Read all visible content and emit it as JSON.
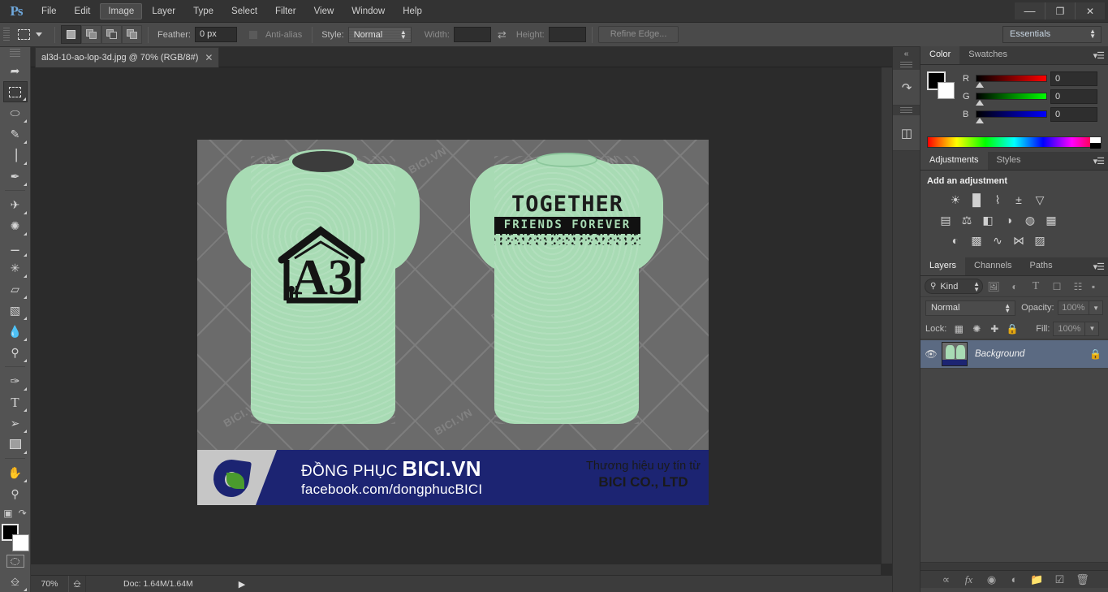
{
  "app": {
    "name": "Ps",
    "menus": [
      "File",
      "Edit",
      "Image",
      "Layer",
      "Type",
      "Select",
      "Filter",
      "View",
      "Window",
      "Help"
    ],
    "active_menu": "Image",
    "window_buttons": {
      "minimize": "—",
      "restore": "❐",
      "close": "✕"
    }
  },
  "options_bar": {
    "tool_icon": "rectangular-marquee-icon",
    "selection_modes": [
      "new-selection",
      "add-to-selection",
      "subtract-from-selection",
      "intersect-with-selection"
    ],
    "active_selection_mode": "new-selection",
    "feather_label": "Feather:",
    "feather_value": "0 px",
    "antialias_label": "Anti-alias",
    "antialias_checked": false,
    "style_label": "Style:",
    "style_value": "Normal",
    "width_label": "Width:",
    "width_value": "",
    "height_label": "Height:",
    "height_value": "",
    "swap_icon": "swap-arrows-icon",
    "refine_edge_label": "Refine Edge...",
    "workspace_value": "Essentials"
  },
  "toolbar": {
    "tools": [
      {
        "name": "move-tool",
        "glyph": "➤",
        "selected": false,
        "hasflyout": false
      },
      {
        "name": "rectangular-marquee-tool",
        "glyph": "⬚",
        "selected": true,
        "hasflyout": true
      },
      {
        "name": "lasso-tool",
        "glyph": "⬭",
        "selected": false,
        "hasflyout": true
      },
      {
        "name": "quick-selection-tool",
        "glyph": "✎",
        "selected": false,
        "hasflyout": true
      },
      {
        "name": "crop-tool",
        "glyph": "⌗",
        "selected": false,
        "hasflyout": true
      },
      {
        "name": "eyedropper-tool",
        "glyph": "✒",
        "selected": false,
        "hasflyout": true
      },
      {
        "name": "spot-healing-brush-tool",
        "glyph": "✐",
        "selected": false,
        "hasflyout": true
      },
      {
        "name": "brush-tool",
        "glyph": "╱",
        "selected": false,
        "hasflyout": true
      },
      {
        "name": "clone-stamp-tool",
        "glyph": "⚒",
        "selected": false,
        "hasflyout": true
      },
      {
        "name": "history-brush-tool",
        "glyph": "✄",
        "selected": false,
        "hasflyout": true
      },
      {
        "name": "eraser-tool",
        "glyph": "▱",
        "selected": false,
        "hasflyout": true
      },
      {
        "name": "gradient-tool",
        "glyph": "▧",
        "selected": false,
        "hasflyout": true
      },
      {
        "name": "blur-tool",
        "glyph": "●",
        "selected": false,
        "hasflyout": true
      },
      {
        "name": "dodge-tool",
        "glyph": "⚲",
        "selected": false,
        "hasflyout": true
      },
      {
        "name": "pen-tool",
        "glyph": "✑",
        "selected": false,
        "hasflyout": true
      },
      {
        "name": "type-tool",
        "glyph": "T",
        "selected": false,
        "hasflyout": true
      },
      {
        "name": "path-selection-tool",
        "glyph": "➤",
        "selected": false,
        "hasflyout": true
      },
      {
        "name": "rectangle-tool",
        "glyph": "■",
        "selected": false,
        "hasflyout": true
      },
      {
        "name": "hand-tool",
        "glyph": "✋",
        "selected": false,
        "hasflyout": true
      },
      {
        "name": "zoom-tool",
        "glyph": "⚲",
        "selected": false,
        "hasflyout": false
      }
    ],
    "foreground_color": "#000000",
    "background_color": "#ffffff",
    "quick_mask_icon": "quick-mask-icon",
    "screen_mode_icon": "screen-mode-icon"
  },
  "document": {
    "tab_title": "al3d-10-ao-lop-3d.jpg @ 70% (RGB/8#)",
    "close_glyph": "✕"
  },
  "artwork": {
    "background_color": "#6b6b6b",
    "shirt_color": "#a8dbb4",
    "watermark_text": "BICI.VN",
    "front_print": {
      "letters": "A3",
      "shape": "house-outline"
    },
    "back_print": {
      "title": "TOGETHER",
      "subtitle": "FRIENDS FOREVER"
    },
    "banner": {
      "brand_prefix": "ĐỒNG PHỤC ",
      "brand_name": "BICI.VN",
      "facebook": "facebook.com/dongphucBICI",
      "tagline": "Thương hiệu uy tín từ",
      "company": "BICI CO., LTD",
      "navy_color": "#1c2472",
      "gray_color": "#c6c6c6"
    }
  },
  "status_bar": {
    "zoom": "70%",
    "doc_icon": "document-icon",
    "doc_info": "Doc: 1.64M/1.64M",
    "arrow": "▶"
  },
  "mini_dock": {
    "collapse_glyph": "«",
    "items": [
      "history-icon",
      "mini-bridge-icon"
    ]
  },
  "color_panel": {
    "tabs": [
      "Color",
      "Swatches"
    ],
    "active_tab": "Color",
    "menu_icon": "panel-menu-icon",
    "channels": [
      {
        "label": "R",
        "value": "0"
      },
      {
        "label": "G",
        "value": "0"
      },
      {
        "label": "B",
        "value": "0"
      }
    ],
    "foreground_color": "#000000",
    "background_color": "#ffffff"
  },
  "adjustments_panel": {
    "tabs": [
      "Adjustments",
      "Styles"
    ],
    "active_tab": "Adjustments",
    "heading": "Add an adjustment",
    "rows": [
      [
        "brightness-contrast-icon",
        "levels-icon",
        "curves-icon",
        "exposure-icon",
        "vibrance-icon"
      ],
      [
        "hue-saturation-icon",
        "color-balance-icon",
        "black-white-icon",
        "photo-filter-icon",
        "channel-mixer-icon",
        "color-lookup-icon"
      ],
      [
        "invert-icon",
        "posterize-icon",
        "threshold-icon",
        "selective-color-icon",
        "gradient-map-icon"
      ]
    ],
    "glyphs": [
      [
        "☀",
        "▐▌",
        "⌇",
        "±",
        "▽"
      ],
      [
        "▤",
        "⚖",
        "◧",
        "◑",
        "◍",
        "▦"
      ],
      [
        "◐",
        "▩",
        "∿",
        "⋈",
        "▨"
      ]
    ]
  },
  "layers_panel": {
    "tabs": [
      "Layers",
      "Channels",
      "Paths"
    ],
    "active_tab": "Layers",
    "menu_icon": "panel-menu-icon",
    "filter": {
      "search_icon": "search-icon",
      "kind_label": "Kind",
      "filter_icons": [
        "pixel-layer-filter-icon",
        "adjustment-layer-filter-icon",
        "type-layer-filter-icon",
        "shape-layer-filter-icon",
        "smart-object-filter-icon"
      ],
      "toggle_icon": "filter-toggle-icon"
    },
    "blend_mode": "Normal",
    "opacity_label": "Opacity:",
    "opacity_value": "100%",
    "lock_label": "Lock:",
    "lock_icons": [
      "lock-transparent-pixels-icon",
      "lock-image-pixels-icon",
      "lock-position-icon",
      "lock-all-icon"
    ],
    "fill_label": "Fill:",
    "fill_value": "100%",
    "layers": [
      {
        "name": "Background",
        "visible": true,
        "locked": true,
        "selected": true,
        "eye_icon": "eye-icon",
        "lock_icon": "lock-icon"
      }
    ],
    "footer_icons": [
      "link-layers-icon",
      "layer-style-fx-icon",
      "add-layer-mask-icon",
      "new-adjustment-layer-icon",
      "new-group-icon",
      "new-layer-icon",
      "delete-layer-icon"
    ],
    "footer_glyphs": [
      "⚭",
      "fx",
      "◉",
      "◑",
      "▰",
      "◰",
      "⌨"
    ]
  }
}
